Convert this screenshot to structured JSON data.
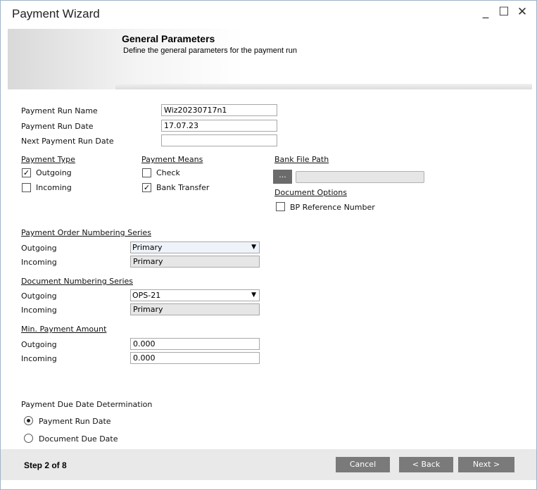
{
  "window": {
    "title": "Payment Wizard",
    "minimize": "_",
    "maximize": "☐",
    "close": "✕"
  },
  "header": {
    "title": "General Parameters",
    "subtitle": "Define the general parameters for the payment run"
  },
  "fields": {
    "run_name_label": "Payment Run Name",
    "run_name_value": "Wiz20230717n1",
    "run_date_label": "Payment Run Date",
    "run_date_value": "17.07.23",
    "next_date_label": "Next Payment Run Date",
    "next_date_value": ""
  },
  "payment_type": {
    "heading": "Payment Type",
    "outgoing": {
      "label": "Outgoing",
      "checked": true
    },
    "incoming": {
      "label": "Incoming",
      "checked": false
    }
  },
  "payment_means": {
    "heading": "Payment Means",
    "check": {
      "label": "Check",
      "checked": false
    },
    "bank_transfer": {
      "label": "Bank Transfer",
      "checked": true
    }
  },
  "bank_file": {
    "heading": "Bank File Path",
    "browse_label": "...",
    "path_value": ""
  },
  "document_options": {
    "heading": "Document Options",
    "bp_ref": {
      "label": "BP Reference Number",
      "checked": false
    }
  },
  "order_series": {
    "heading": "Payment Order Numbering Series",
    "outgoing_label": "Outgoing",
    "outgoing_value": "Primary",
    "incoming_label": "Incoming",
    "incoming_value": "Primary"
  },
  "doc_series": {
    "heading": "Document Numbering Series",
    "outgoing_label": "Outgoing",
    "outgoing_value": "OPS-21",
    "incoming_label": "Incoming",
    "incoming_value": "Primary"
  },
  "min_amount": {
    "heading": "Min. Payment Amount",
    "outgoing_label": "Outgoing",
    "outgoing_value": "0.000",
    "incoming_label": "Incoming",
    "incoming_value": "0.000"
  },
  "due_date": {
    "heading": "Payment Due Date Determination",
    "option1": {
      "label": "Payment Run Date",
      "selected": true
    },
    "option2": {
      "label": "Document Due Date",
      "selected": false
    }
  },
  "footer": {
    "step": "Step 2 of 8",
    "cancel": "Cancel",
    "back": "< Back",
    "next": "Next >"
  },
  "colors": {
    "button_bg": "#7a7a7a",
    "footer_bg": "#e9e9e9",
    "titlebar_accent": "#9fb3c8"
  }
}
